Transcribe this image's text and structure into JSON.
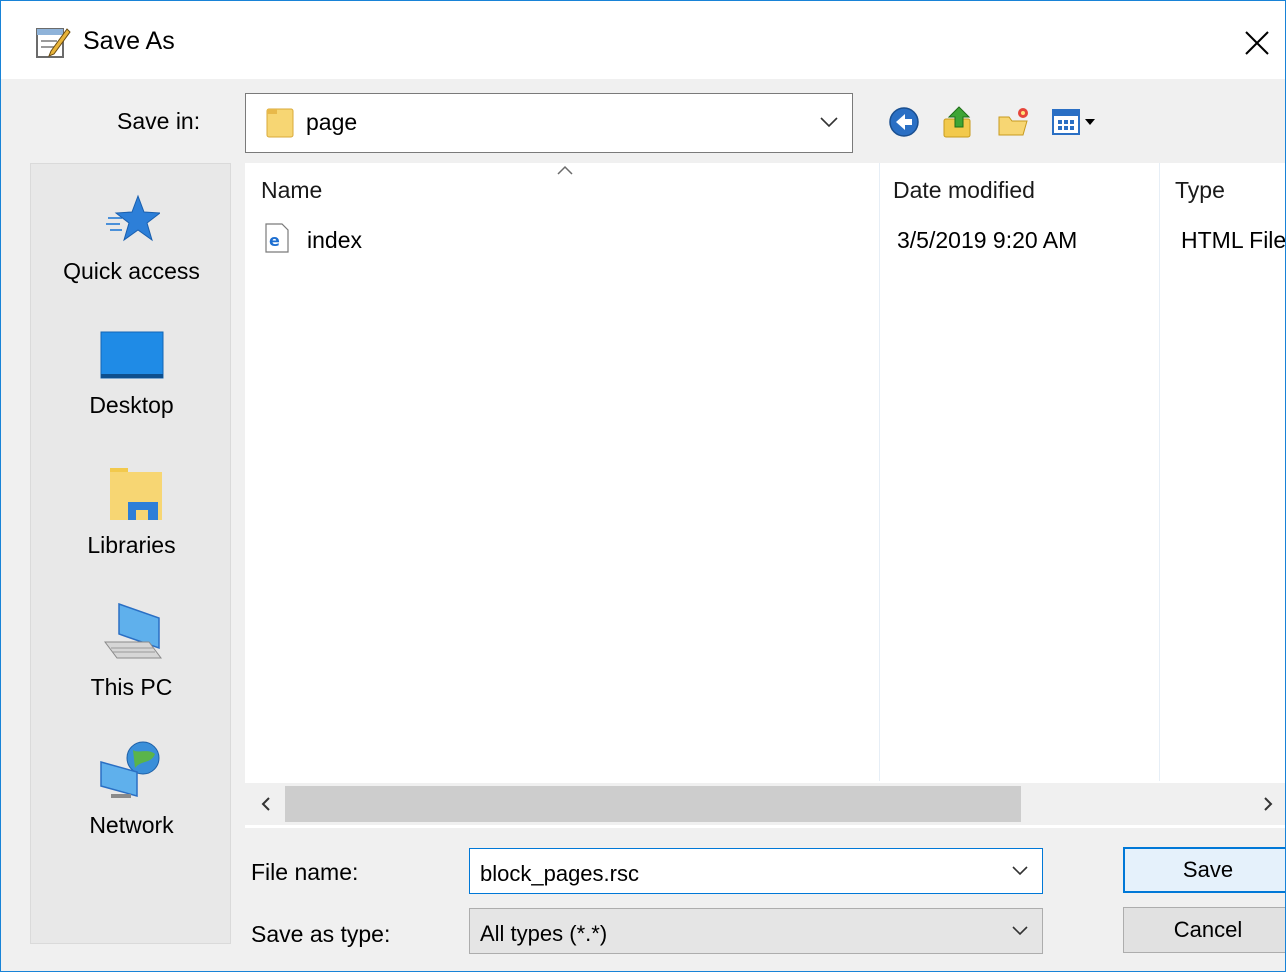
{
  "window": {
    "title": "Save As",
    "close_label": "×"
  },
  "save_in": {
    "label": "Save in:",
    "value": "page"
  },
  "toolbar": {
    "icons": [
      "back-icon",
      "up-folder-icon",
      "new-folder-icon",
      "view-menu-icon"
    ]
  },
  "places": [
    {
      "label": "Quick access",
      "icon": "quick-access-icon"
    },
    {
      "label": "Desktop",
      "icon": "desktop-icon"
    },
    {
      "label": "Libraries",
      "icon": "libraries-icon"
    },
    {
      "label": "This PC",
      "icon": "this-pc-icon"
    },
    {
      "label": "Network",
      "icon": "network-icon"
    }
  ],
  "file_list": {
    "columns": [
      "Name",
      "Date modified",
      "Type"
    ],
    "rows": [
      {
        "name": "index",
        "date": "3/5/2019 9:20 AM",
        "type": "HTML File",
        "icon": "html-file-icon"
      }
    ]
  },
  "file_name": {
    "label": "File name:",
    "value": "block_pages.rsc"
  },
  "save_as_type": {
    "label": "Save as type:",
    "value": "All types (*.*)"
  },
  "buttons": {
    "save": "Save",
    "cancel": "Cancel"
  },
  "colors": {
    "accent": "#0078d7",
    "window_bg": "#f0f0f0",
    "list_bg": "#ffffff"
  }
}
